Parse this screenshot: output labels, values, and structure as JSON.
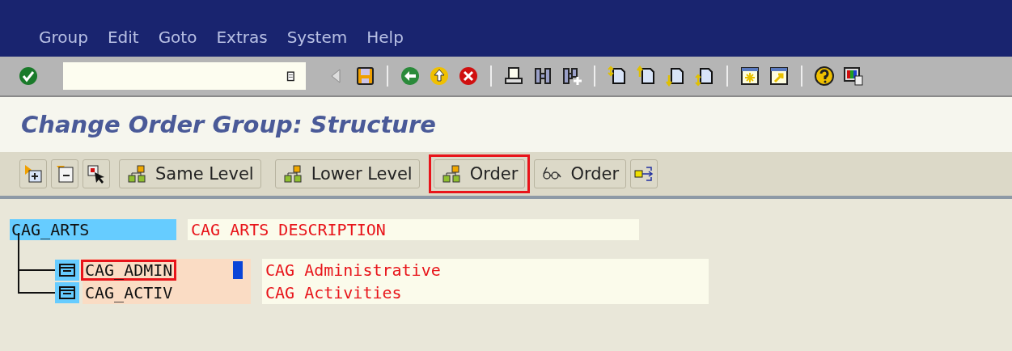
{
  "menu_bar": {
    "items": [
      "Group",
      "Edit",
      "Goto",
      "Extras",
      "System",
      "Help"
    ]
  },
  "screen_title": "Change Order Group: Structure",
  "app_toolbar": {
    "buttons": [
      {
        "label": "Same Level",
        "highlighted": false
      },
      {
        "label": "Lower Level",
        "highlighted": false
      },
      {
        "label": "Order",
        "highlighted": true
      }
    ],
    "display_button": {
      "label": "Order"
    }
  },
  "tree": {
    "root": {
      "key": "CAG_ARTS",
      "description": "CAG ARTS DESCRIPTION",
      "selected": true,
      "children": [
        {
          "key": "CAG_ADMIN",
          "description": "CAG Administrative",
          "highlighted": true,
          "cursor": true
        },
        {
          "key": "CAG_ACTIV",
          "description": "CAG Activities",
          "highlighted": false,
          "cursor": false
        }
      ]
    }
  }
}
